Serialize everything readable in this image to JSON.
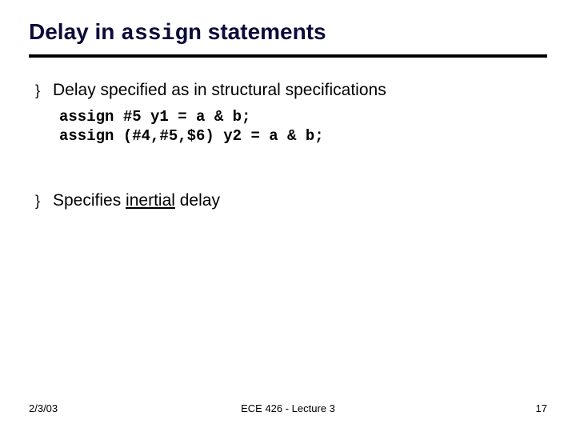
{
  "title": {
    "part1": "Delay in ",
    "code": "assign",
    "part2": " statements"
  },
  "bullets": {
    "b1": "Delay specified as in structural specifications",
    "b2_pre": "Specifies ",
    "b2_ul": "inertial",
    "b2_post": " delay"
  },
  "code": {
    "line1": "assign #5 y1 = a & b;",
    "line2": "assign (#4,#5,$6) y2 = a & b;"
  },
  "footer": {
    "date": "2/3/03",
    "center": "ECE 426 - Lecture 3",
    "page": "17"
  },
  "glyphs": {
    "bullet": "}"
  }
}
